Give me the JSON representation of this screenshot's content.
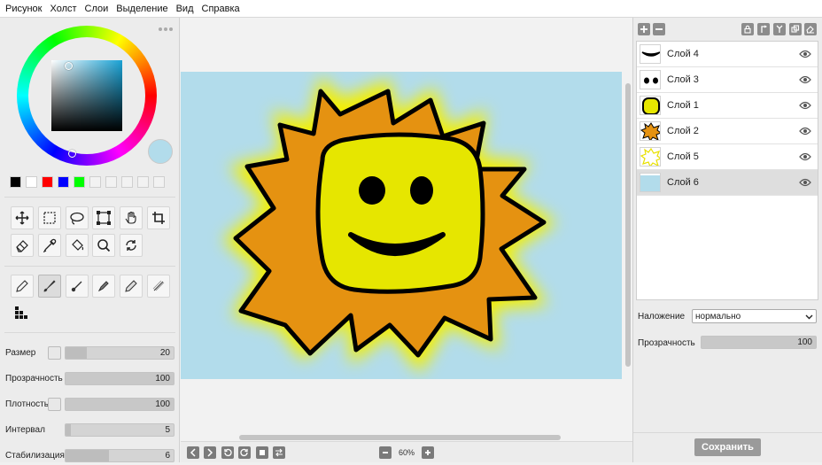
{
  "menu": [
    "Рисунок",
    "Холст",
    "Слои",
    "Выделение",
    "Вид",
    "Справка"
  ],
  "colors": {
    "primary": "#b2dceb",
    "palette": [
      "#000000",
      "#ffffff",
      "#ff0000",
      "#0000ff",
      "#00ff00",
      "#f2f2f2",
      "#f2f2f2",
      "#f2f2f2",
      "#f2f2f2",
      "#f2f2f2"
    ]
  },
  "tools": {
    "selection": [
      "move-icon",
      "rect-select-icon",
      "lasso-icon",
      "transform-icon",
      "hand-icon",
      "crop-icon"
    ],
    "utility": [
      "eraser-icon",
      "eyedropper-icon",
      "fill-bucket-icon",
      "zoom-icon",
      "rotate-icon"
    ],
    "brushes": [
      "pencil-icon",
      "brush-icon",
      "round-brush-icon",
      "marker-icon",
      "pen-icon",
      "airbrush-icon",
      "pixel-brush-icon"
    ]
  },
  "sliders": [
    {
      "label": "Размер",
      "value": "20",
      "fraction": 0.2,
      "checkbox": true
    },
    {
      "label": "Прозрачность",
      "value": "100",
      "fraction": 1.0,
      "checkbox": false
    },
    {
      "label": "Плотность",
      "value": "100",
      "fraction": 1.0,
      "checkbox": true
    },
    {
      "label": "Интервал",
      "value": "5",
      "fraction": 0.05,
      "checkbox": false
    },
    {
      "label": "Стабилизация",
      "value": "6",
      "fraction": 0.4,
      "checkbox": false
    }
  ],
  "zoom": {
    "value": "60%"
  },
  "layers": [
    {
      "name": "Слой 4",
      "thumb": "mouth",
      "selected": false
    },
    {
      "name": "Слой 3",
      "thumb": "eyes",
      "selected": false
    },
    {
      "name": "Слой 1",
      "thumb": "face",
      "selected": false
    },
    {
      "name": "Слой 2",
      "thumb": "rays",
      "selected": false
    },
    {
      "name": "Слой 5",
      "thumb": "glow",
      "selected": false
    },
    {
      "name": "Слой 6",
      "thumb": "background",
      "selected": true
    }
  ],
  "blend": {
    "label": "Наложение",
    "value": "нормально"
  },
  "layer_opacity": {
    "label": "Прозрачность",
    "value": "100",
    "fraction": 1.0
  },
  "save_label": "Сохранить"
}
